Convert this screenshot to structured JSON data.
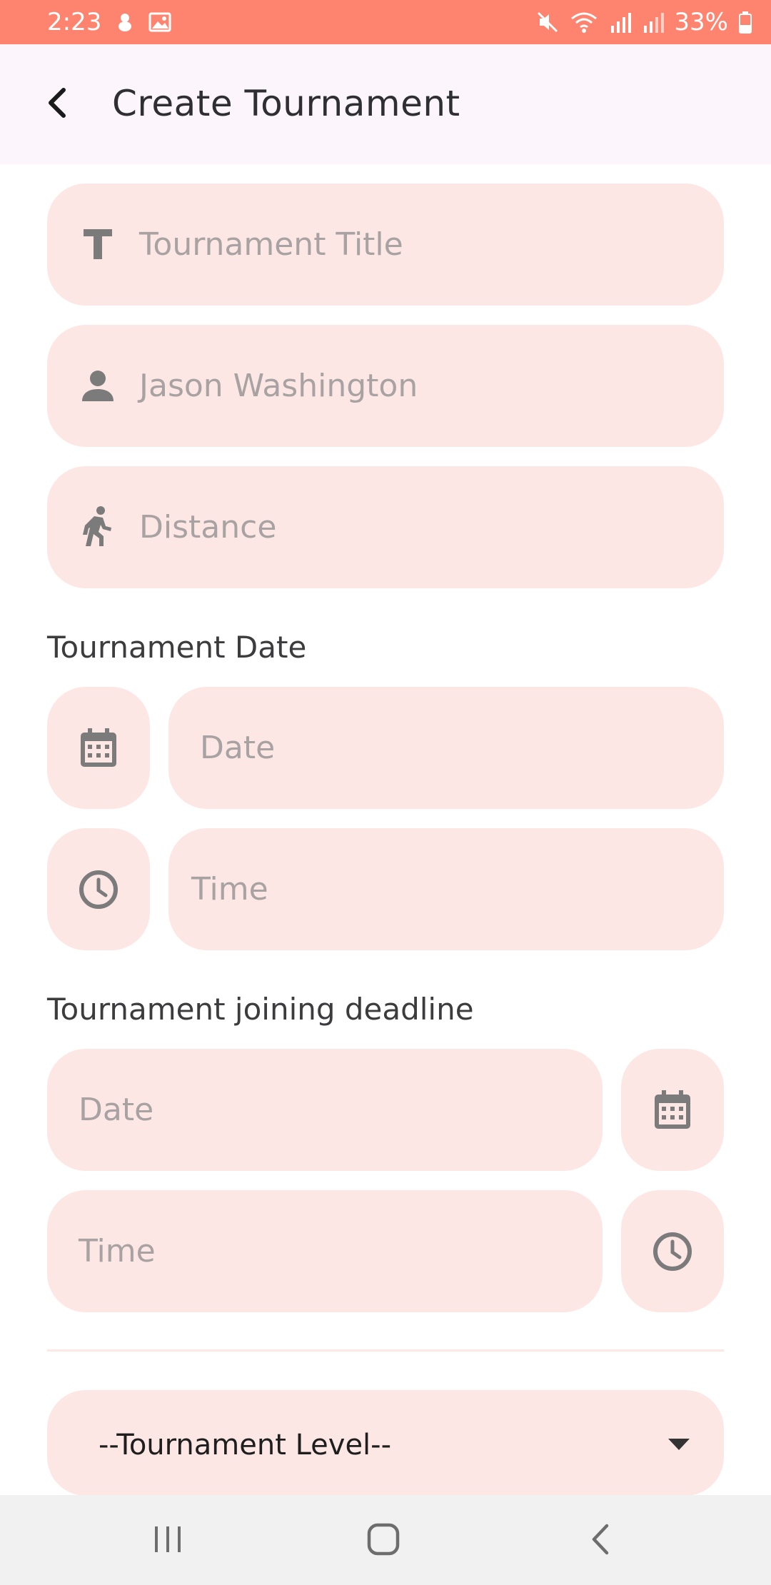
{
  "status_bar": {
    "time": "2:23",
    "battery": "33%",
    "icons": [
      "notification-icon",
      "image-icon",
      "mute-icon",
      "wifi-icon",
      "signal-icon",
      "signal-icon-2",
      "battery-icon"
    ]
  },
  "app_bar": {
    "title": "Create Tournament",
    "back_icon": "chevron-left-icon"
  },
  "form": {
    "title_field": {
      "placeholder": "Tournament Title",
      "icon": "text-title-icon"
    },
    "organizer_field": {
      "placeholder": "Jason Washington",
      "icon": "person-icon"
    },
    "distance_field": {
      "placeholder": "Distance",
      "icon": "running-icon"
    },
    "tournament_date": {
      "label": "Tournament Date",
      "date_placeholder": "Date",
      "time_placeholder": "Time"
    },
    "joining_deadline": {
      "label": "Tournament joining deadline",
      "date_placeholder": "Date",
      "time_placeholder": "Time"
    },
    "level_dropdown": {
      "selected": "--Tournament Level--",
      "icon": "caret-down-icon"
    }
  },
  "colors": {
    "status_bar": "#FF8470",
    "app_bar": "#FCF6FC",
    "field_bg": "#FDE7E5",
    "icon": "#7b7b7b",
    "placeholder": "#a8a2a2",
    "nav_bar": "#F1F1F1"
  },
  "nav_bar": {
    "buttons": [
      "recent-apps-icon",
      "home-icon",
      "back-icon"
    ]
  }
}
